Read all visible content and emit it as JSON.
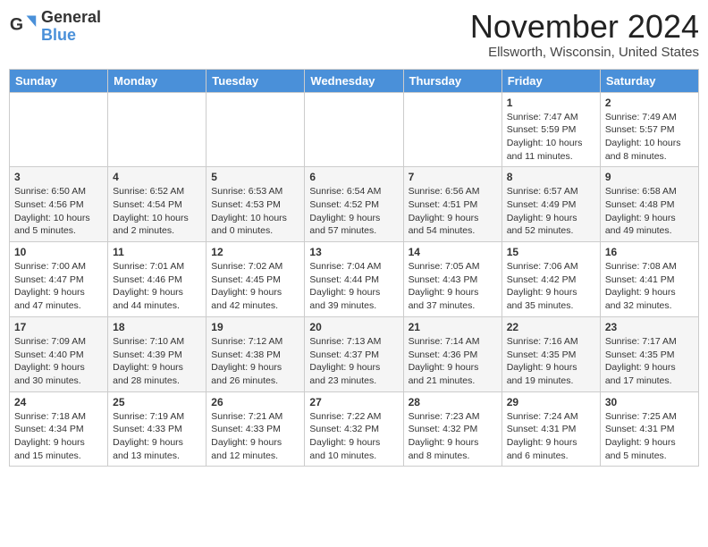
{
  "header": {
    "logo_line1": "General",
    "logo_line2": "Blue",
    "month_year": "November 2024",
    "location": "Ellsworth, Wisconsin, United States"
  },
  "weekdays": [
    "Sunday",
    "Monday",
    "Tuesday",
    "Wednesday",
    "Thursday",
    "Friday",
    "Saturday"
  ],
  "weeks": [
    [
      {
        "day": "",
        "info": ""
      },
      {
        "day": "",
        "info": ""
      },
      {
        "day": "",
        "info": ""
      },
      {
        "day": "",
        "info": ""
      },
      {
        "day": "",
        "info": ""
      },
      {
        "day": "1",
        "info": "Sunrise: 7:47 AM\nSunset: 5:59 PM\nDaylight: 10 hours and 11 minutes."
      },
      {
        "day": "2",
        "info": "Sunrise: 7:49 AM\nSunset: 5:57 PM\nDaylight: 10 hours and 8 minutes."
      }
    ],
    [
      {
        "day": "3",
        "info": "Sunrise: 6:50 AM\nSunset: 4:56 PM\nDaylight: 10 hours and 5 minutes."
      },
      {
        "day": "4",
        "info": "Sunrise: 6:52 AM\nSunset: 4:54 PM\nDaylight: 10 hours and 2 minutes."
      },
      {
        "day": "5",
        "info": "Sunrise: 6:53 AM\nSunset: 4:53 PM\nDaylight: 10 hours and 0 minutes."
      },
      {
        "day": "6",
        "info": "Sunrise: 6:54 AM\nSunset: 4:52 PM\nDaylight: 9 hours and 57 minutes."
      },
      {
        "day": "7",
        "info": "Sunrise: 6:56 AM\nSunset: 4:51 PM\nDaylight: 9 hours and 54 minutes."
      },
      {
        "day": "8",
        "info": "Sunrise: 6:57 AM\nSunset: 4:49 PM\nDaylight: 9 hours and 52 minutes."
      },
      {
        "day": "9",
        "info": "Sunrise: 6:58 AM\nSunset: 4:48 PM\nDaylight: 9 hours and 49 minutes."
      }
    ],
    [
      {
        "day": "10",
        "info": "Sunrise: 7:00 AM\nSunset: 4:47 PM\nDaylight: 9 hours and 47 minutes."
      },
      {
        "day": "11",
        "info": "Sunrise: 7:01 AM\nSunset: 4:46 PM\nDaylight: 9 hours and 44 minutes."
      },
      {
        "day": "12",
        "info": "Sunrise: 7:02 AM\nSunset: 4:45 PM\nDaylight: 9 hours and 42 minutes."
      },
      {
        "day": "13",
        "info": "Sunrise: 7:04 AM\nSunset: 4:44 PM\nDaylight: 9 hours and 39 minutes."
      },
      {
        "day": "14",
        "info": "Sunrise: 7:05 AM\nSunset: 4:43 PM\nDaylight: 9 hours and 37 minutes."
      },
      {
        "day": "15",
        "info": "Sunrise: 7:06 AM\nSunset: 4:42 PM\nDaylight: 9 hours and 35 minutes."
      },
      {
        "day": "16",
        "info": "Sunrise: 7:08 AM\nSunset: 4:41 PM\nDaylight: 9 hours and 32 minutes."
      }
    ],
    [
      {
        "day": "17",
        "info": "Sunrise: 7:09 AM\nSunset: 4:40 PM\nDaylight: 9 hours and 30 minutes."
      },
      {
        "day": "18",
        "info": "Sunrise: 7:10 AM\nSunset: 4:39 PM\nDaylight: 9 hours and 28 minutes."
      },
      {
        "day": "19",
        "info": "Sunrise: 7:12 AM\nSunset: 4:38 PM\nDaylight: 9 hours and 26 minutes."
      },
      {
        "day": "20",
        "info": "Sunrise: 7:13 AM\nSunset: 4:37 PM\nDaylight: 9 hours and 23 minutes."
      },
      {
        "day": "21",
        "info": "Sunrise: 7:14 AM\nSunset: 4:36 PM\nDaylight: 9 hours and 21 minutes."
      },
      {
        "day": "22",
        "info": "Sunrise: 7:16 AM\nSunset: 4:35 PM\nDaylight: 9 hours and 19 minutes."
      },
      {
        "day": "23",
        "info": "Sunrise: 7:17 AM\nSunset: 4:35 PM\nDaylight: 9 hours and 17 minutes."
      }
    ],
    [
      {
        "day": "24",
        "info": "Sunrise: 7:18 AM\nSunset: 4:34 PM\nDaylight: 9 hours and 15 minutes."
      },
      {
        "day": "25",
        "info": "Sunrise: 7:19 AM\nSunset: 4:33 PM\nDaylight: 9 hours and 13 minutes."
      },
      {
        "day": "26",
        "info": "Sunrise: 7:21 AM\nSunset: 4:33 PM\nDaylight: 9 hours and 12 minutes."
      },
      {
        "day": "27",
        "info": "Sunrise: 7:22 AM\nSunset: 4:32 PM\nDaylight: 9 hours and 10 minutes."
      },
      {
        "day": "28",
        "info": "Sunrise: 7:23 AM\nSunset: 4:32 PM\nDaylight: 9 hours and 8 minutes."
      },
      {
        "day": "29",
        "info": "Sunrise: 7:24 AM\nSunset: 4:31 PM\nDaylight: 9 hours and 6 minutes."
      },
      {
        "day": "30",
        "info": "Sunrise: 7:25 AM\nSunset: 4:31 PM\nDaylight: 9 hours and 5 minutes."
      }
    ]
  ]
}
